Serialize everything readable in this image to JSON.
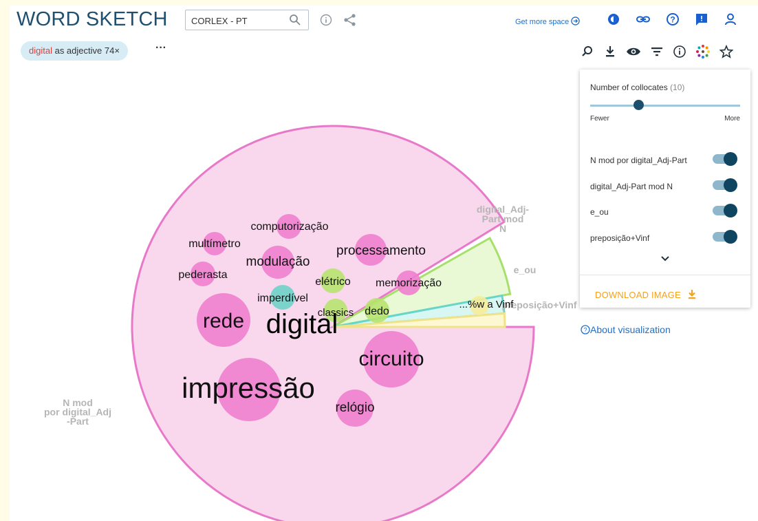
{
  "app": {
    "title": "WORD SKETCH",
    "corpus": "CORLEX - PT",
    "get_more_space": "Get more space"
  },
  "query_chip": {
    "lemma": "digital",
    "rest": "as adjective 74×"
  },
  "more_label": "···",
  "panel": {
    "collocates_label": "Number of collocates",
    "collocates_count": "(10)",
    "collocates_slider_fraction": 0.32,
    "fewer": "Fewer",
    "more": "More",
    "relations": [
      {
        "label": "N mod por digital_Adj-Part",
        "enabled": true
      },
      {
        "label": "digital_Adj-Part mod N",
        "enabled": true
      },
      {
        "label": "e_ou",
        "enabled": true
      },
      {
        "label": "preposição+Vinf",
        "enabled": true
      }
    ],
    "download": "DOWNLOAD IMAGE"
  },
  "about": "About visualization",
  "chart_data": {
    "type": "word-sketch",
    "center_word": "digital",
    "slices": [
      {
        "relation": "N mod por digital_Adj-Part",
        "label_lines": [
          "N mod",
          "por digital_Adj",
          "-Part"
        ],
        "fill": "#f9d8ee",
        "stroke": "#e879c9"
      },
      {
        "relation": "digital_Adj-Part mod N",
        "label_lines": [
          "digital_Adj-",
          "Part mod",
          "N"
        ],
        "fill": "#e9f9d6",
        "stroke": "#a6e06a"
      },
      {
        "relation": "e_ou",
        "label_lines": [
          "e_ou"
        ],
        "fill": "#d8f7f2",
        "stroke": "#66d6cc"
      },
      {
        "relation": "preposição+Vinf",
        "label_lines": [
          "preposição+Vinf"
        ],
        "fill": "#fdf7d2",
        "stroke": "#efe38a"
      }
    ],
    "collocates": [
      {
        "word": "impressão",
        "relation": "N mod por digital_Adj-Part",
        "color": "#ee7fce"
      },
      {
        "word": "rede",
        "relation": "N mod por digital_Adj-Part",
        "color": "#ee7fce"
      },
      {
        "word": "circuito",
        "relation": "N mod por digital_Adj-Part",
        "color": "#ee7fce"
      },
      {
        "word": "relógio",
        "relation": "N mod por digital_Adj-Part",
        "color": "#ee7fce"
      },
      {
        "word": "modulação",
        "relation": "N mod por digital_Adj-Part",
        "color": "#ee7fce"
      },
      {
        "word": "multímetro",
        "relation": "N mod por digital_Adj-Part",
        "color": "#ee7fce"
      },
      {
        "word": "pederasta",
        "relation": "N mod por digital_Adj-Part",
        "color": "#ee7fce"
      },
      {
        "word": "computorização",
        "relation": "N mod por digital_Adj-Part",
        "color": "#ee7fce"
      },
      {
        "word": "processamento",
        "relation": "N mod por digital_Adj-Part",
        "color": "#ee7fce"
      },
      {
        "word": "memorização",
        "relation": "N mod por digital_Adj-Part",
        "color": "#ee7fce"
      },
      {
        "word": "imperdível",
        "relation": "e_ou",
        "color": "#6ed3c7"
      },
      {
        "word": "elétrico",
        "relation": "digital_Adj-Part mod N",
        "color": "#b7e36f"
      },
      {
        "word": "classics",
        "relation": "digital_Adj-Part mod N",
        "color": "#b7e36f"
      },
      {
        "word": "dedo",
        "relation": "digital_Adj-Part mod N",
        "color": "#b7e36f"
      },
      {
        "word": "...%w a Vinf",
        "relation": "preposição+Vinf",
        "color": "#f6ec9a"
      }
    ]
  }
}
